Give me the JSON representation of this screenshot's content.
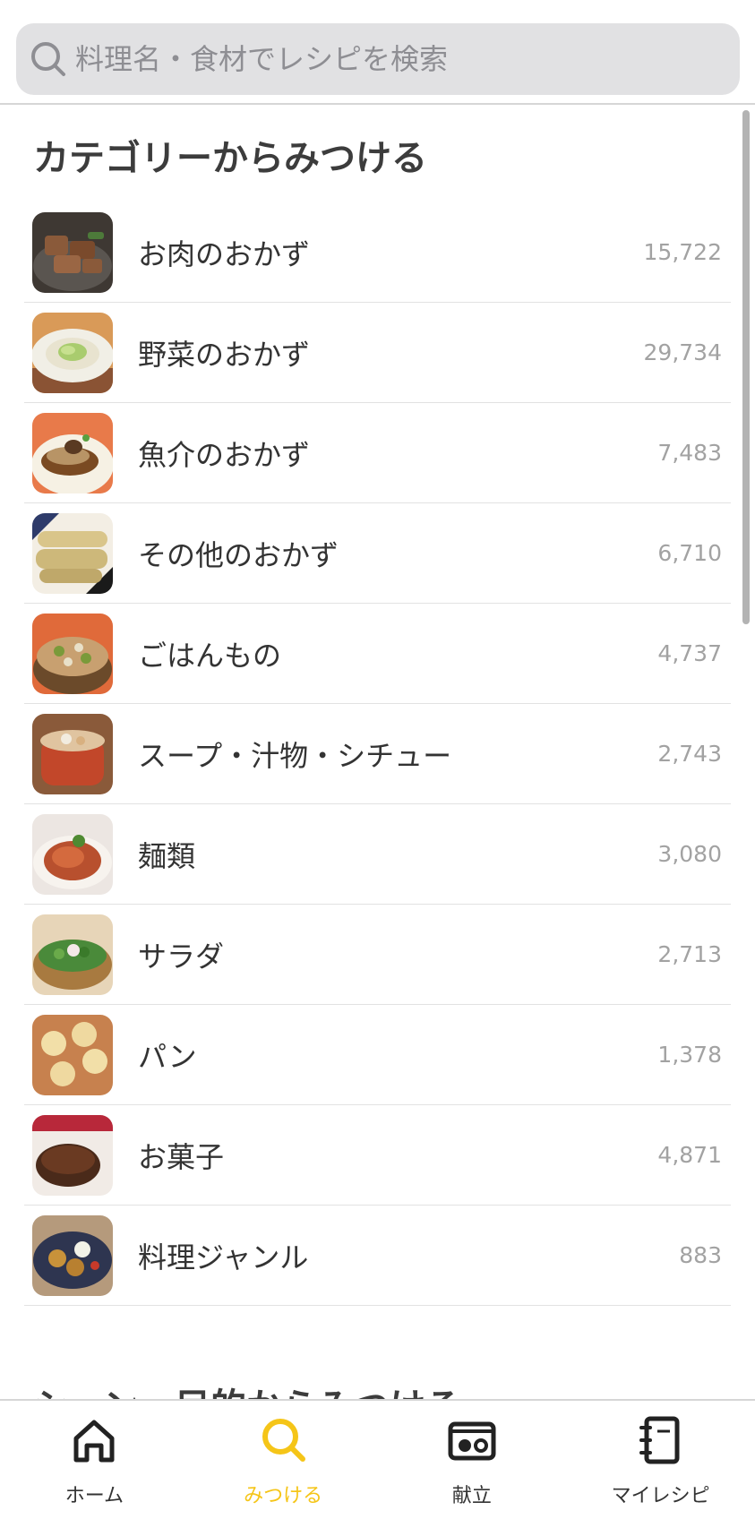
{
  "search": {
    "placeholder": "料理名・食材でレシピを検索"
  },
  "category_section": {
    "title": "カテゴリーからみつける",
    "items": [
      {
        "label": "お肉のおかず",
        "count": "15,722",
        "thumb": "meat-dish-photo"
      },
      {
        "label": "野菜のおかず",
        "count": "29,734",
        "thumb": "vegetable-dish-photo"
      },
      {
        "label": "魚介のおかず",
        "count": "7,483",
        "thumb": "seafood-dish-photo"
      },
      {
        "label": "その他のおかず",
        "count": "6,710",
        "thumb": "other-dish-photo"
      },
      {
        "label": "ごはんもの",
        "count": "4,737",
        "thumb": "rice-dish-photo"
      },
      {
        "label": "スープ・汁物・シチュー",
        "count": "2,743",
        "thumb": "soup-photo"
      },
      {
        "label": "麺類",
        "count": "3,080",
        "thumb": "noodles-photo"
      },
      {
        "label": "サラダ",
        "count": "2,713",
        "thumb": "salad-photo"
      },
      {
        "label": "パン",
        "count": "1,378",
        "thumb": "bread-photo"
      },
      {
        "label": "お菓子",
        "count": "4,871",
        "thumb": "sweets-photo"
      },
      {
        "label": "料理ジャンル",
        "count": "883",
        "thumb": "cuisine-genre-photo"
      }
    ]
  },
  "scene_section": {
    "title": "シーン・目的からみつける"
  },
  "tab_bar": {
    "tabs": [
      {
        "label": "ホーム",
        "icon": "home-icon",
        "active": false
      },
      {
        "label": "みつける",
        "icon": "search-icon",
        "active": true
      },
      {
        "label": "献立",
        "icon": "menu-plan-icon",
        "active": false
      },
      {
        "label": "マイレシピ",
        "icon": "notebook-icon",
        "active": false
      }
    ]
  },
  "colors": {
    "accent": "#f5c518",
    "text": "#333333",
    "count_text": "#a2a2a2",
    "search_bg": "#e1e1e3"
  }
}
